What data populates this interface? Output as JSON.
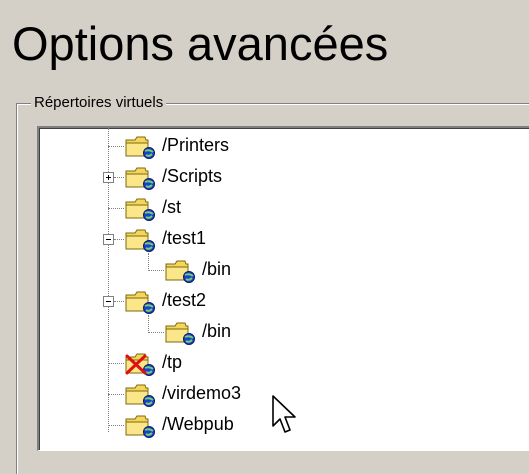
{
  "page": {
    "title": "Options avancées"
  },
  "virtual_directories": {
    "group_label": "Répertoires virtuels",
    "items": [
      {
        "label": "/Printers",
        "icon": "virtual-folder-icon",
        "expander": null
      },
      {
        "label": "/Scripts",
        "icon": "virtual-folder-icon",
        "expander": "collapsed"
      },
      {
        "label": "/st",
        "icon": "virtual-folder-icon",
        "expander": null
      },
      {
        "label": "/test1",
        "icon": "virtual-folder-icon",
        "expander": "expanded",
        "children": [
          {
            "label": "/bin",
            "icon": "virtual-folder-icon"
          }
        ]
      },
      {
        "label": "/test2",
        "icon": "virtual-folder-icon",
        "expander": "expanded",
        "children": [
          {
            "label": "/bin",
            "icon": "virtual-folder-icon"
          }
        ]
      },
      {
        "label": "/tp",
        "icon": "broken-virtual-folder-icon",
        "expander": null
      },
      {
        "label": "/virdemo3",
        "icon": "virtual-folder-icon",
        "expander": null
      },
      {
        "label": "/Webpub",
        "icon": "virtual-folder-icon",
        "expander": null
      }
    ]
  },
  "colors": {
    "window_background": "#d4d0c8",
    "folder_yellow": "#f7d85a",
    "globe_blue": "#1c3fd0",
    "error_red": "#e01010"
  }
}
